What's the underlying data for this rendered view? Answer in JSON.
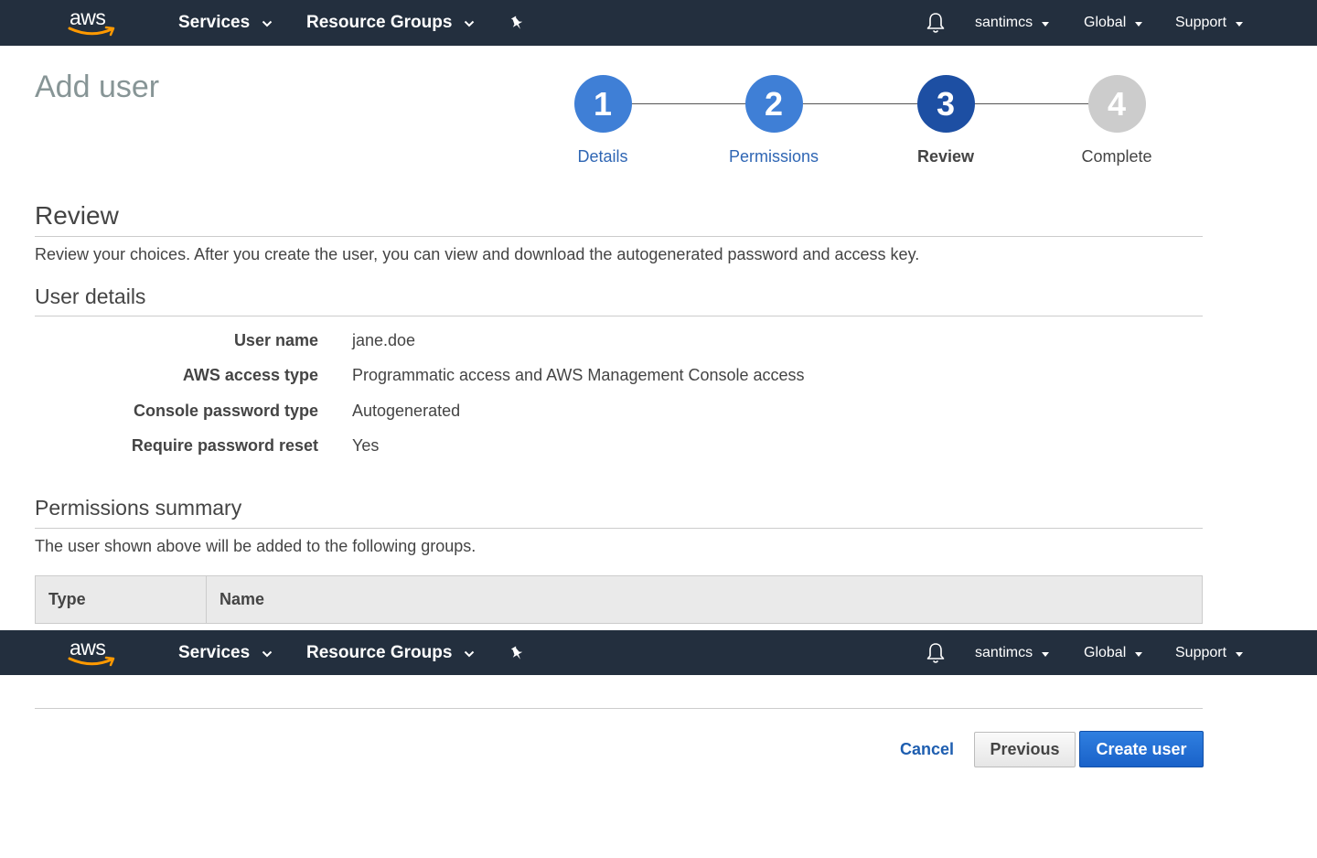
{
  "colors": {
    "navbar_bg": "#232f3e",
    "step_done": "#3f7fd6",
    "step_active": "#1d4fa3",
    "step_pending": "#cccccc",
    "link_blue": "#2f66b4",
    "primary_button": "#1f69d1"
  },
  "navbar": {
    "logo_text": "aws",
    "services_label": "Services",
    "resource_groups_label": "Resource Groups",
    "pin_icon": "pushpin-icon",
    "bell_icon": "bell-icon",
    "account_label": "santimcs",
    "region_label": "Global",
    "support_label": "Support"
  },
  "page": {
    "title": "Add user"
  },
  "wizard": {
    "steps": [
      {
        "number": "1",
        "label": "Details",
        "state": "done"
      },
      {
        "number": "2",
        "label": "Permissions",
        "state": "done"
      },
      {
        "number": "3",
        "label": "Review",
        "state": "active"
      },
      {
        "number": "4",
        "label": "Complete",
        "state": "pending"
      }
    ]
  },
  "review": {
    "heading": "Review",
    "description": "Review your choices. After you create the user, you can view and download the autogenerated password and access key."
  },
  "user_details": {
    "heading": "User details",
    "rows": [
      {
        "label": "User name",
        "value": "jane.doe"
      },
      {
        "label": "AWS access type",
        "value": "Programmatic access and AWS Management Console access"
      },
      {
        "label": "Console password type",
        "value": "Autogenerated"
      },
      {
        "label": "Require password reset",
        "value": "Yes"
      }
    ]
  },
  "permissions_summary": {
    "heading": "Permissions summary",
    "description": "The user shown above will be added to the following groups.",
    "columns": [
      "Type",
      "Name"
    ]
  },
  "footer": {
    "cancel_label": "Cancel",
    "previous_label": "Previous",
    "create_label": "Create user"
  }
}
